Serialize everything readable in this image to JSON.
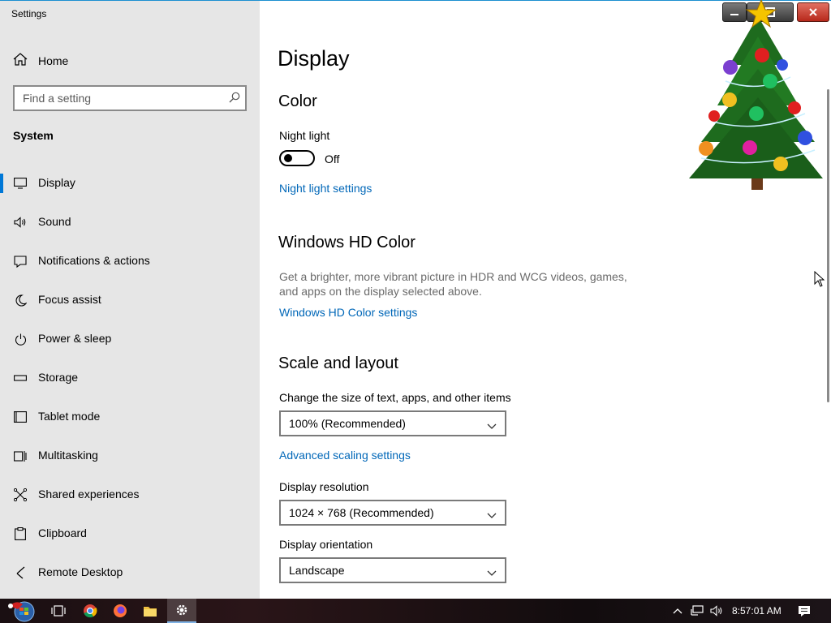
{
  "window": {
    "title": "Settings"
  },
  "sidebar": {
    "home_label": "Home",
    "search_placeholder": "Find a setting",
    "section_label": "System",
    "items": [
      {
        "label": "Display",
        "icon": "monitor-icon"
      },
      {
        "label": "Sound",
        "icon": "speaker-icon"
      },
      {
        "label": "Notifications & actions",
        "icon": "notification-icon"
      },
      {
        "label": "Focus assist",
        "icon": "moon-icon"
      },
      {
        "label": "Power & sleep",
        "icon": "power-icon"
      },
      {
        "label": "Storage",
        "icon": "storage-icon"
      },
      {
        "label": "Tablet mode",
        "icon": "tablet-icon"
      },
      {
        "label": "Multitasking",
        "icon": "multitasking-icon"
      },
      {
        "label": "Shared experiences",
        "icon": "shared-icon"
      },
      {
        "label": "Clipboard",
        "icon": "clipboard-icon"
      },
      {
        "label": "Remote Desktop",
        "icon": "remote-desktop-icon"
      }
    ],
    "active_item": "Display"
  },
  "main": {
    "page_title": "Display",
    "color": {
      "heading": "Color",
      "night_light_label": "Night light",
      "night_light_state": "Off",
      "night_light_link": "Night light settings"
    },
    "hd_color": {
      "heading": "Windows HD Color",
      "description": "Get a brighter, more vibrant picture in HDR and WCG videos, games, and apps on the display selected above.",
      "link": "Windows HD Color settings"
    },
    "scale_layout": {
      "heading": "Scale and layout",
      "size_label": "Change the size of text, apps, and other items",
      "size_value": "100% (Recommended)",
      "advanced_link": "Advanced scaling settings",
      "resolution_label": "Display resolution",
      "resolution_value": "1024 × 768 (Recommended)",
      "orientation_label": "Display orientation",
      "orientation_value": "Landscape"
    }
  },
  "taskbar": {
    "apps": [
      "start-button",
      "task-view-icon",
      "chrome-icon",
      "firefox-icon",
      "file-explorer-icon",
      "settings-icon"
    ],
    "clock": "8:57:01 AM"
  },
  "colors": {
    "accent": "#0078d7",
    "link": "#0067b8",
    "sidebar_bg": "#e6e6e6"
  }
}
